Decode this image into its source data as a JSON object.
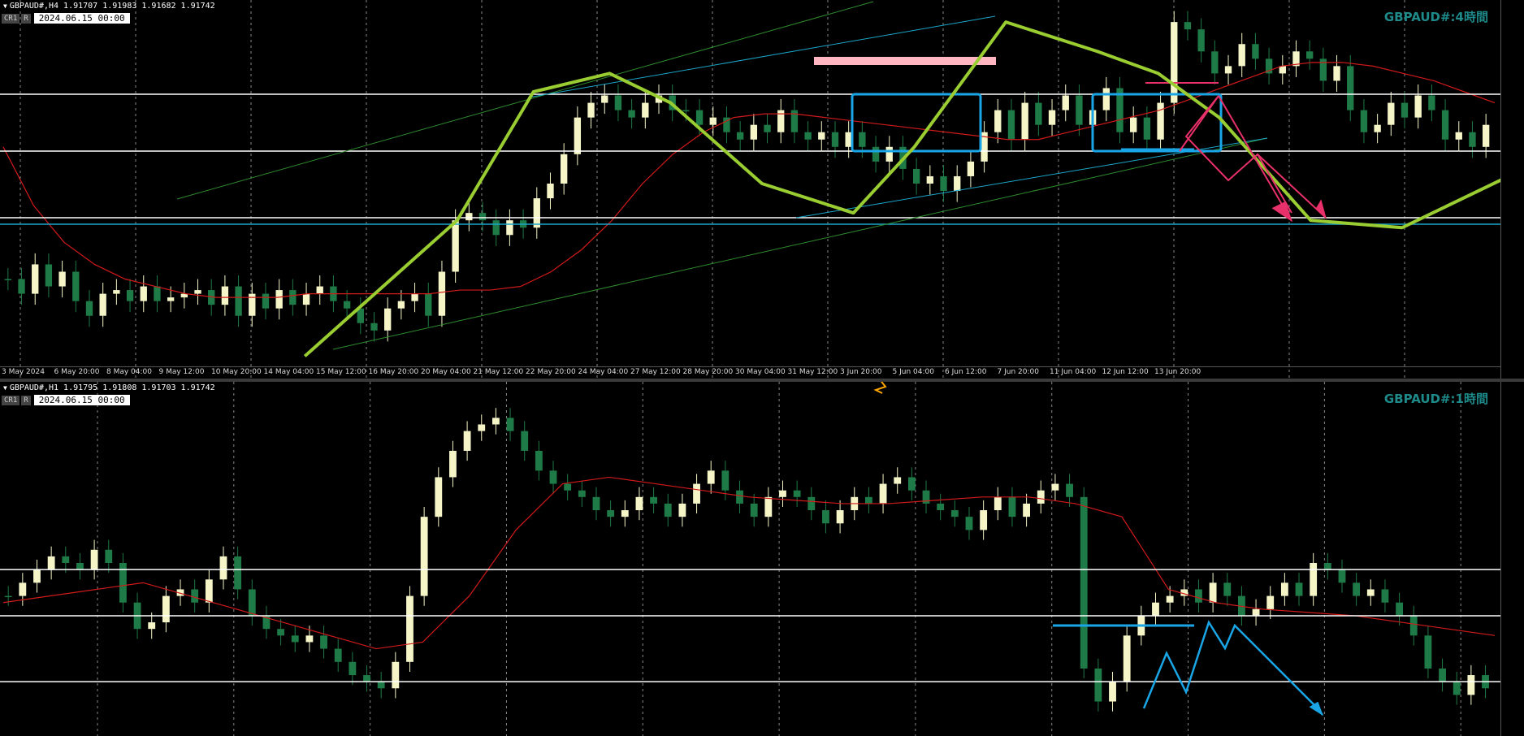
{
  "top": {
    "header": "GBPAUD#,H4  1.91707 1.91983 1.91682 1.91742",
    "badges": [
      "CR1",
      "R"
    ],
    "date": "2024.06.15 00:00",
    "watermark": "GBPAUD#:4時間",
    "time_labels": [
      "3 May 2024",
      "6 May 20:00",
      "8 May 04:00",
      "9 May 12:00",
      "10 May 20:00",
      "14 May 04:00",
      "15 May 12:00",
      "16 May 20:00",
      "20 May 04:00",
      "21 May 12:00",
      "22 May 20:00",
      "24 May 04:00",
      "27 May 12:00",
      "28 May 20:00",
      "30 May 04:00",
      "31 May 12:00",
      "3 Jun 20:00",
      "5 Jun 04:00",
      "6 Jun 12:00",
      "7 Jun 20:00",
      "11 Jun 04:00",
      "12 Jun 12:00",
      "13 Jun 20:00"
    ]
  },
  "bottom": {
    "header": "GBPAUD#,H1  1.91795 1.91808 1.91703 1.91742",
    "badges": [
      "CR1",
      "R"
    ],
    "date": "2024.06.15 00:00",
    "watermark": "GBPAUD#:1時間"
  },
  "colors": {
    "bull": "#f5f5c8",
    "bear": "#1e7a46",
    "ma": "#d11a1a",
    "curve": "#9acd32",
    "box": "#1aa6e6",
    "pink": "#ffb6c1",
    "magenta": "#e8306a",
    "trend_green": "#2e8b2e",
    "trend_cyan": "#1aa6c8",
    "orange": "#ffa500"
  },
  "chart_data": [
    {
      "type": "candlestick",
      "timeframe": "H4",
      "x": [
        "3 May 2024",
        "6 May 20:00",
        "8 May 04:00",
        "9 May 12:00",
        "10 May 20:00",
        "14 May 04:00",
        "15 May 12:00",
        "16 May 20:00",
        "20 May 04:00",
        "21 May 12:00",
        "22 May 20:00",
        "24 May 04:00",
        "27 May 12:00",
        "28 May 20:00",
        "30 May 04:00",
        "31 May 12:00",
        "3 Jun 20:00",
        "5 Jun 04:00",
        "6 Jun 12:00",
        "7 Jun 20:00",
        "11 Jun 04:00",
        "12 Jun 12:00",
        "13 Jun 20:00"
      ],
      "close_path": [
        0.76,
        0.8,
        0.72,
        0.78,
        0.74,
        0.82,
        0.86,
        0.8,
        0.79,
        0.82,
        0.78,
        0.82,
        0.81,
        0.8,
        0.79,
        0.83,
        0.78,
        0.86,
        0.8,
        0.84,
        0.79,
        0.83,
        0.8,
        0.78,
        0.82,
        0.84,
        0.88,
        0.9,
        0.84,
        0.82,
        0.8,
        0.86,
        0.74,
        0.6,
        0.58,
        0.6,
        0.64,
        0.6,
        0.62,
        0.54,
        0.5,
        0.42,
        0.32,
        0.28,
        0.26,
        0.3,
        0.32,
        0.28,
        0.26,
        0.3,
        0.3,
        0.34,
        0.32,
        0.36,
        0.38,
        0.34,
        0.36,
        0.3,
        0.36,
        0.38,
        0.36,
        0.4,
        0.36,
        0.4,
        0.44,
        0.4,
        0.46,
        0.5,
        0.48,
        0.52,
        0.48,
        0.44,
        0.36,
        0.3,
        0.38,
        0.28,
        0.34,
        0.3,
        0.26,
        0.34,
        0.3,
        0.24,
        0.36,
        0.32,
        0.38,
        0.28,
        0.06,
        0.08,
        0.14,
        0.2,
        0.18,
        0.12,
        0.16,
        0.2,
        0.18,
        0.14,
        0.16,
        0.22,
        0.18,
        0.3,
        0.36,
        0.34,
        0.28,
        0.32,
        0.26,
        0.3,
        0.38,
        0.36,
        0.4,
        0.34
      ],
      "ma_path": [
        0.4,
        0.56,
        0.66,
        0.72,
        0.76,
        0.78,
        0.8,
        0.81,
        0.81,
        0.81,
        0.8,
        0.8,
        0.8,
        0.8,
        0.8,
        0.79,
        0.79,
        0.78,
        0.74,
        0.68,
        0.6,
        0.5,
        0.42,
        0.36,
        0.32,
        0.31,
        0.31,
        0.32,
        0.33,
        0.34,
        0.35,
        0.36,
        0.37,
        0.38,
        0.38,
        0.36,
        0.34,
        0.32,
        0.3,
        0.27,
        0.24,
        0.21,
        0.18,
        0.17,
        0.17,
        0.18,
        0.2,
        0.22,
        0.25,
        0.28
      ],
      "curve_path": [
        [
          0.2,
          0.97
        ],
        [
          0.3,
          0.6
        ],
        [
          0.35,
          0.25
        ],
        [
          0.4,
          0.2
        ],
        [
          0.44,
          0.28
        ],
        [
          0.5,
          0.5
        ],
        [
          0.56,
          0.58
        ],
        [
          0.6,
          0.4
        ],
        [
          0.66,
          0.06
        ],
        [
          0.72,
          0.14
        ],
        [
          0.76,
          0.2
        ],
        [
          0.8,
          0.32
        ],
        [
          0.86,
          0.6
        ],
        [
          0.92,
          0.62
        ],
        [
          0.99,
          0.48
        ]
      ]
    },
    {
      "type": "candlestick",
      "timeframe": "H1",
      "close_path": [
        0.6,
        0.56,
        0.52,
        0.48,
        0.5,
        0.52,
        0.46,
        0.5,
        0.62,
        0.7,
        0.68,
        0.6,
        0.58,
        0.62,
        0.55,
        0.48,
        0.58,
        0.66,
        0.7,
        0.72,
        0.74,
        0.72,
        0.76,
        0.8,
        0.84,
        0.86,
        0.88,
        0.8,
        0.6,
        0.36,
        0.24,
        0.16,
        0.1,
        0.08,
        0.06,
        0.1,
        0.16,
        0.22,
        0.26,
        0.28,
        0.3,
        0.34,
        0.36,
        0.34,
        0.3,
        0.32,
        0.36,
        0.32,
        0.26,
        0.22,
        0.28,
        0.32,
        0.36,
        0.3,
        0.28,
        0.3,
        0.34,
        0.38,
        0.34,
        0.3,
        0.32,
        0.26,
        0.24,
        0.28,
        0.32,
        0.34,
        0.36,
        0.4,
        0.34,
        0.3,
        0.36,
        0.32,
        0.28,
        0.26,
        0.3,
        0.82,
        0.92,
        0.86,
        0.72,
        0.66,
        0.62,
        0.6,
        0.58,
        0.62,
        0.56,
        0.6,
        0.66,
        0.64,
        0.6,
        0.56,
        0.6,
        0.5,
        0.52,
        0.56,
        0.6,
        0.58,
        0.62,
        0.66,
        0.72,
        0.82,
        0.86,
        0.9,
        0.84,
        0.88
      ],
      "ma_path": [
        0.62,
        0.6,
        0.58,
        0.56,
        0.6,
        0.64,
        0.68,
        0.72,
        0.76,
        0.74,
        0.6,
        0.4,
        0.26,
        0.24,
        0.26,
        0.28,
        0.3,
        0.31,
        0.32,
        0.32,
        0.31,
        0.3,
        0.3,
        0.32,
        0.36,
        0.58,
        0.62,
        0.64,
        0.65,
        0.66,
        0.68,
        0.7,
        0.72
      ],
      "levels": [
        0.52,
        0.66,
        0.86
      ]
    }
  ]
}
